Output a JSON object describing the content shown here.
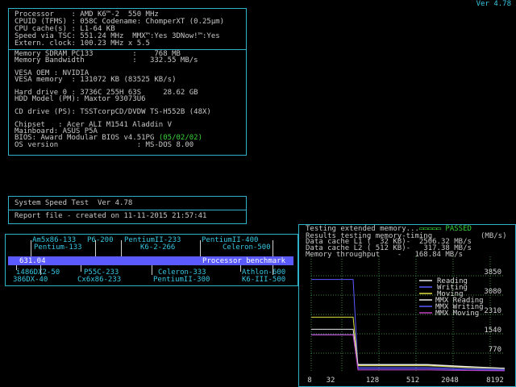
{
  "version": "Ver 4.78",
  "sysinfo": {
    "lines": [
      "Processor    : AMD K6™-2  550 MHz",
      "CPUID (TFMS) : 058C Codename: ChomperXT (0.25µm)",
      "CPU cache(s) : L1-64 KB",
      "Speed via TSC: 551.24 MHz  MMX™:Yes 3DNow!™:Yes",
      "Extern. clock: 100.23 MHz x 5.5"
    ],
    "memory_lines": [
      "Memory SDRAM PC133         :    768 MB",
      "Memory Bandwidth           :   332.55 MB/s",
      "",
      "VESA OEM : NVIDIA",
      "VESA memory  : 131072 KB (83525 KB/s)",
      "",
      "Hard drive 0 : 3736C 255H 63S     28.62 GB",
      "HDD Model (PM): Maxtor 93073U6",
      "",
      "CD drive (PS): TSSTcorpCD/DVDW TS-H552B (48X)",
      "",
      "Chipset   : Acer ALI M1541 Aladdin V",
      "Mainboard: ASUS P5A"
    ],
    "bios_prefix": "BIOS: Award Modular BIOS v4.51PG ",
    "bios_date": "(05/02/02)",
    "os_line": "OS version                  : MS-DOS 8.00"
  },
  "speedtest": {
    "title": "System Speed Test  Ver 4.78",
    "report": "Report file - created on 11-11-2015 21:57:41"
  },
  "benchmark": {
    "value": "631.04",
    "label": "Processor benchmark",
    "top_row1": [
      "Am5x86-133",
      "P6-200",
      "PentiumII-233",
      "PentiumII-400"
    ],
    "top_row2": [
      "Pentium-133",
      "K6-2-266",
      "Celeron-500"
    ],
    "bottom_row1": [
      "i486DX2-50",
      "P55C-233",
      "Celeron-333",
      "Athlon-600"
    ],
    "bottom_row2": [
      "386DX-40",
      "Cx6x86-233",
      "PentiumII-300",
      "K6-III-500"
    ]
  },
  "memtest": {
    "status_text": "Testing extended memory...",
    "status_done": "PASSED",
    "results_line": "Results testing memory-timing",
    "units": "(MB/s)",
    "rows": [
      "Data cache L1 (  32 KB)-  2506.32 MB/s",
      "Data cache L2 ( 512 KB)-   317.38 MB/s",
      "Memory throughput    -   168.84 MB/s"
    ],
    "legend": [
      "Reading",
      "Writing",
      "Moving",
      "MMX Reading",
      "MMX Writing",
      "MMX Moving"
    ],
    "legend_colors": [
      "#e8e8e8",
      "#5a5aff",
      "#e0e040",
      "#e8e8e8",
      "#5a5aff",
      "#c040c0"
    ]
  },
  "chart_data": {
    "type": "line",
    "x_ticks": [
      "8",
      "32",
      "128",
      "512",
      "2048",
      "8192"
    ],
    "y_ticks": [
      "3850",
      "3080",
      "2310",
      "1540",
      "770"
    ],
    "x_scale": "log",
    "series": [
      {
        "name": "Reading",
        "color": "#e8e8e8",
        "values": [
          1720,
          1720,
          320,
          320,
          240,
          170
        ]
      },
      {
        "name": "Writing",
        "color": "#5a5aff",
        "values": [
          3700,
          3700,
          200,
          200,
          150,
          120
        ]
      },
      {
        "name": "Moving",
        "color": "#e0e040",
        "values": [
          2200,
          2200,
          270,
          270,
          200,
          160
        ]
      },
      {
        "name": "MMX Reading",
        "color": "#e8e8e8",
        "values": [
          1500,
          1500,
          300,
          300,
          220,
          170
        ]
      },
      {
        "name": "MMX Writing",
        "color": "#5a5aff",
        "values": [
          1500,
          1500,
          150,
          150,
          100,
          90
        ]
      },
      {
        "name": "MMX Moving",
        "color": "#c040c0",
        "values": [
          1500,
          1500,
          100,
          100,
          80,
          70
        ]
      }
    ]
  }
}
